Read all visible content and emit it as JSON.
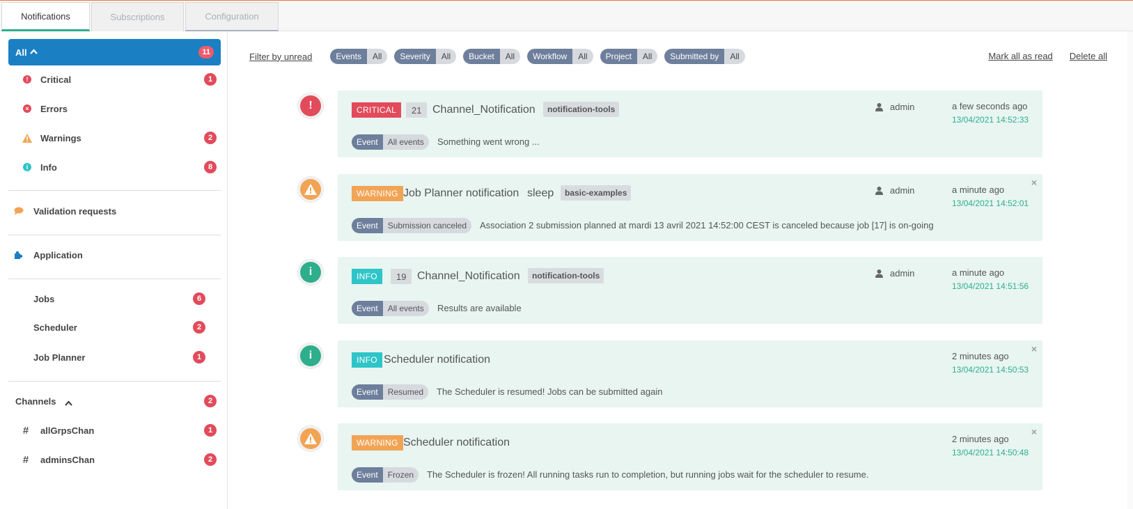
{
  "tabs": [
    {
      "label": "Notifications",
      "active": true
    },
    {
      "label": "Subscriptions",
      "active": false
    },
    {
      "label": "Configuration",
      "active": false
    }
  ],
  "sidebar": {
    "all": {
      "label": "All",
      "count": "11"
    },
    "severities": [
      {
        "label": "Critical",
        "count": "1",
        "icon": "exclamation-circle-icon",
        "color": "#e24b5b"
      },
      {
        "label": "Errors",
        "count": "",
        "icon": "times-circle-icon",
        "color": "#e24b5b"
      },
      {
        "label": "Warnings",
        "count": "2",
        "icon": "warning-triangle-icon",
        "color": "#f2a455"
      },
      {
        "label": "Info",
        "count": "8",
        "icon": "info-circle-icon",
        "color": "#2ec5c8"
      }
    ],
    "validation": {
      "label": "Validation requests",
      "icon": "comment-icon"
    },
    "application": {
      "label": "Application",
      "icon": "puzzle-icon"
    },
    "sources": [
      {
        "label": "Jobs",
        "count": "6"
      },
      {
        "label": "Scheduler",
        "count": "2"
      },
      {
        "label": "Job Planner",
        "count": "1"
      }
    ],
    "channels": {
      "label": "Channels",
      "count": "2"
    },
    "channel_items": [
      {
        "label": "allGrpsChan",
        "count": "1"
      },
      {
        "label": "adminsChan",
        "count": "2"
      }
    ]
  },
  "filters": {
    "unread_link": "Filter by unread",
    "pills": [
      {
        "key": "Events",
        "value": "All"
      },
      {
        "key": "Severity",
        "value": "All"
      },
      {
        "key": "Bucket",
        "value": "All"
      },
      {
        "key": "Workflow",
        "value": "All"
      },
      {
        "key": "Project",
        "value": "All"
      },
      {
        "key": "Submitted by",
        "value": "All"
      }
    ],
    "mark_all": "Mark all as read",
    "delete_all": "Delete all"
  },
  "notifications": [
    {
      "severity": "CRITICAL",
      "number": "21",
      "title": "Channel_Notification",
      "tag": "notification-tools",
      "user": "admin",
      "time": "a few seconds ago",
      "date": "13/04/2021 14:52:33",
      "event": "Event",
      "event_type": "All events",
      "message": "Something went wrong ..."
    },
    {
      "severity": "WARNING",
      "title": "Job Planner notification",
      "subtitle": "sleep",
      "tag": "basic-examples",
      "user": "admin",
      "time": "a minute ago",
      "date": "13/04/2021 14:52:01",
      "event": "Event",
      "event_type": "Submission canceled",
      "message": "Association 2 submission planned at mardi 13 avril 2021 14:52:00 CEST is canceled because job [17] is on-going"
    },
    {
      "severity": "INFO",
      "number": "19",
      "title": "Channel_Notification",
      "tag": "notification-tools",
      "user": "admin",
      "time": "a minute ago",
      "date": "13/04/2021 14:51:56",
      "event": "Event",
      "event_type": "All events",
      "message": "Results are available"
    },
    {
      "severity": "INFO",
      "title": "Scheduler notification",
      "time": "2 minutes ago",
      "date": "13/04/2021 14:50:53",
      "event": "Event",
      "event_type": "Resumed",
      "message": "The Scheduler is resumed! Jobs can be submitted again"
    },
    {
      "severity": "WARNING",
      "title": "Scheduler notification",
      "time": "2 minutes ago",
      "date": "13/04/2021 14:50:48",
      "event": "Event",
      "event_type": "Frozen",
      "message": "The Scheduler is frozen! All running tasks run to completion, but running jobs wait for the scheduler to resume."
    }
  ],
  "colors": {
    "accent": "#1b7fc4",
    "critical": "#e24b5b",
    "warning": "#f2a455",
    "info": "#2ec5c8",
    "date": "#2eae8c"
  }
}
